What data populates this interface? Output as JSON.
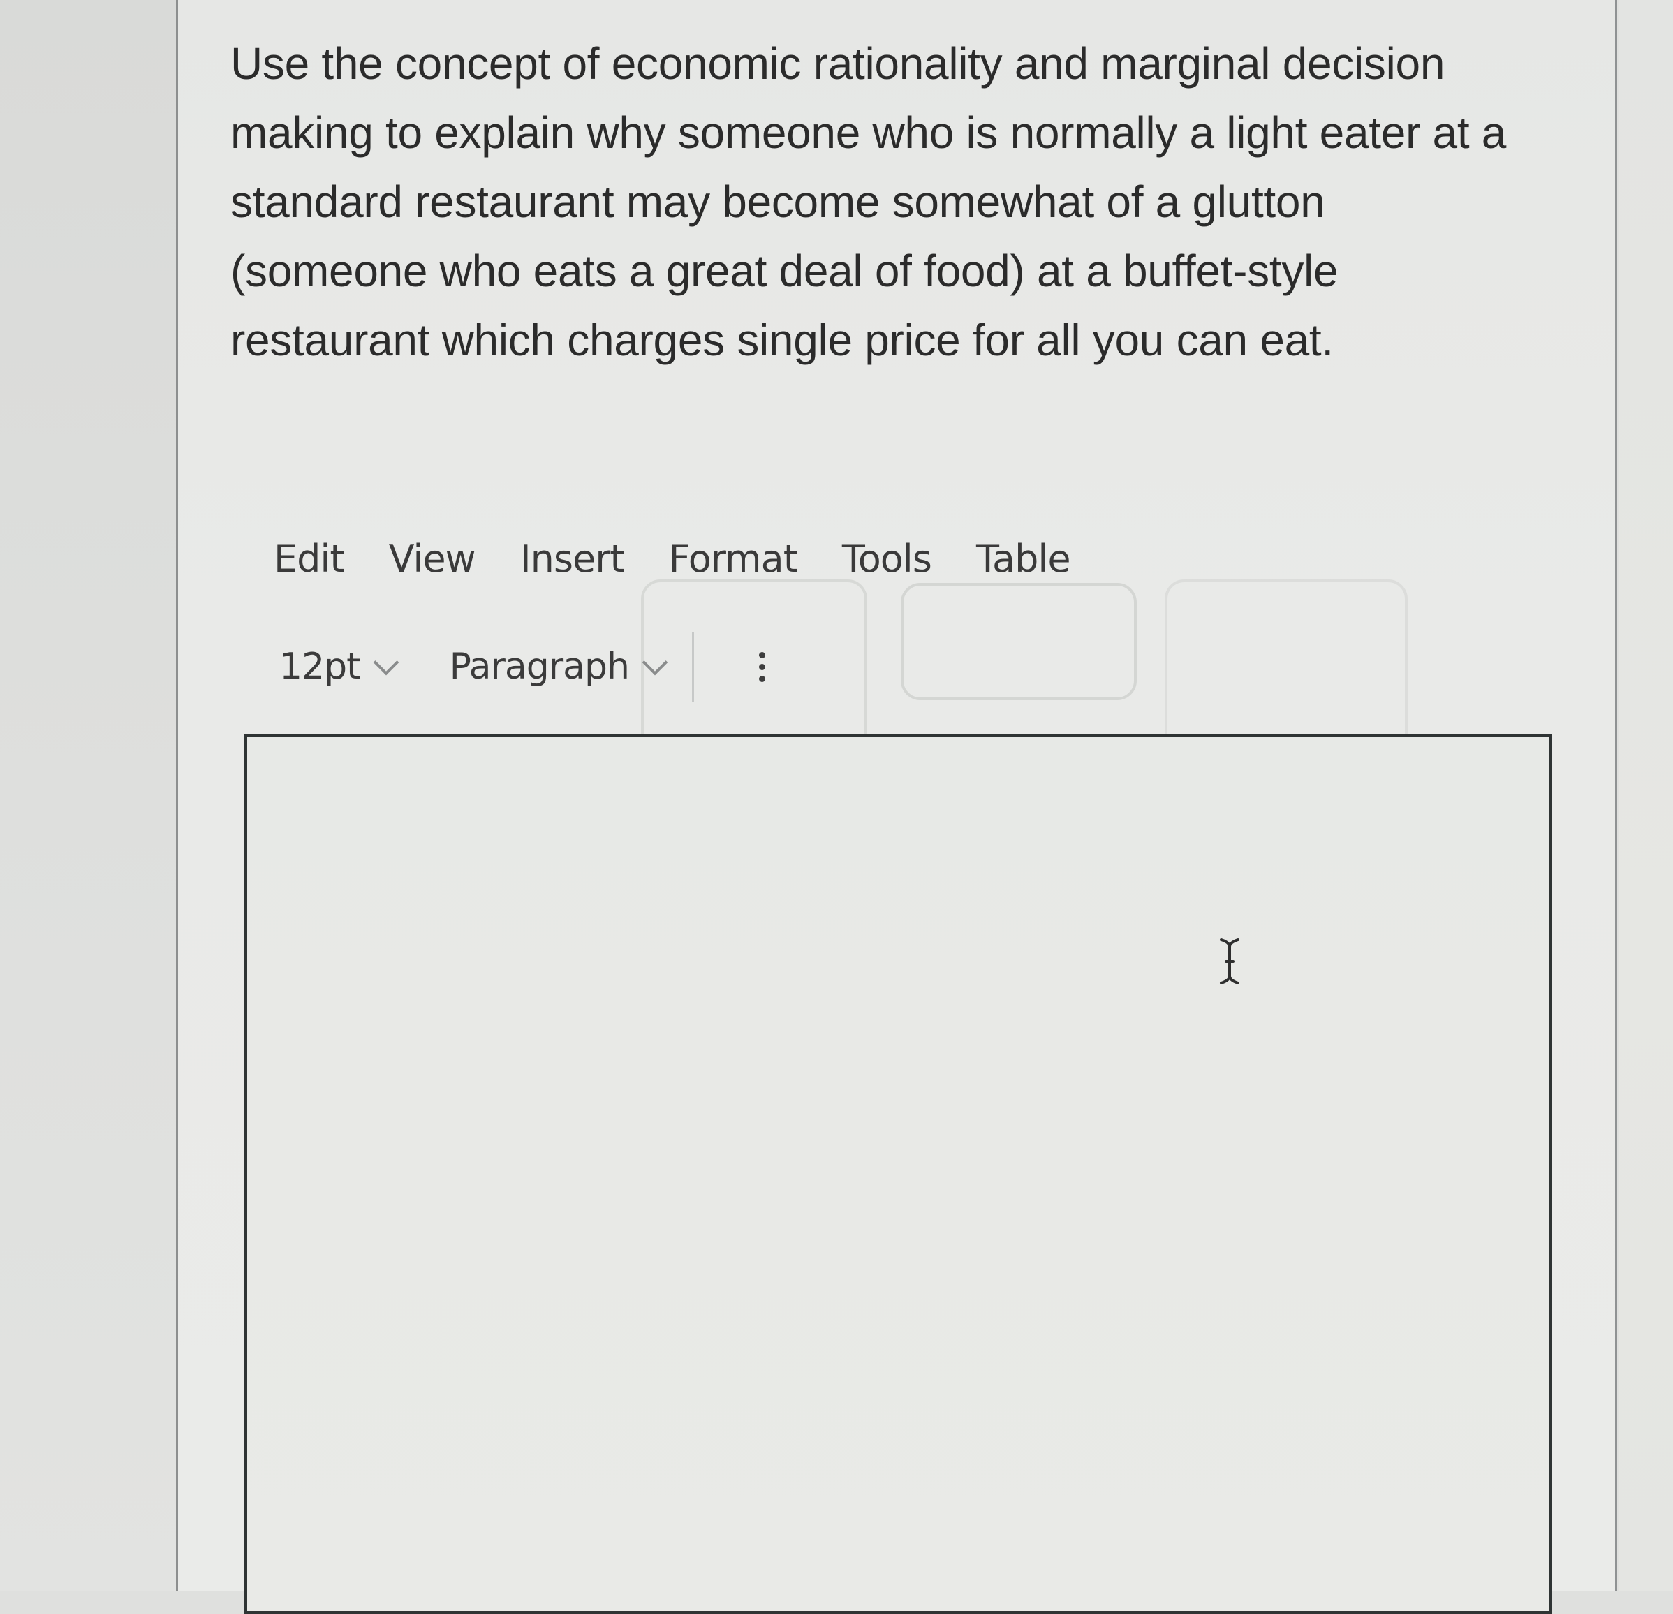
{
  "question": {
    "lines": [
      "Use the concept of economic rationality and marginal decision",
      "making to explain why someone who is normally a light eater at a",
      "standard restaurant may become somewhat of a glutton",
      "(someone who eats a great deal of food) at a buffet-style",
      "restaurant which charges single price for all you can eat."
    ]
  },
  "editor": {
    "menu": [
      "Edit",
      "View",
      "Insert",
      "Format",
      "Tools",
      "Table"
    ],
    "toolbar": {
      "font_size": "12pt",
      "block_format": "Paragraph",
      "more_icon": "vertical-ellipsis-icon"
    },
    "content": "",
    "cursor_icon": "text-cursor-icon"
  }
}
